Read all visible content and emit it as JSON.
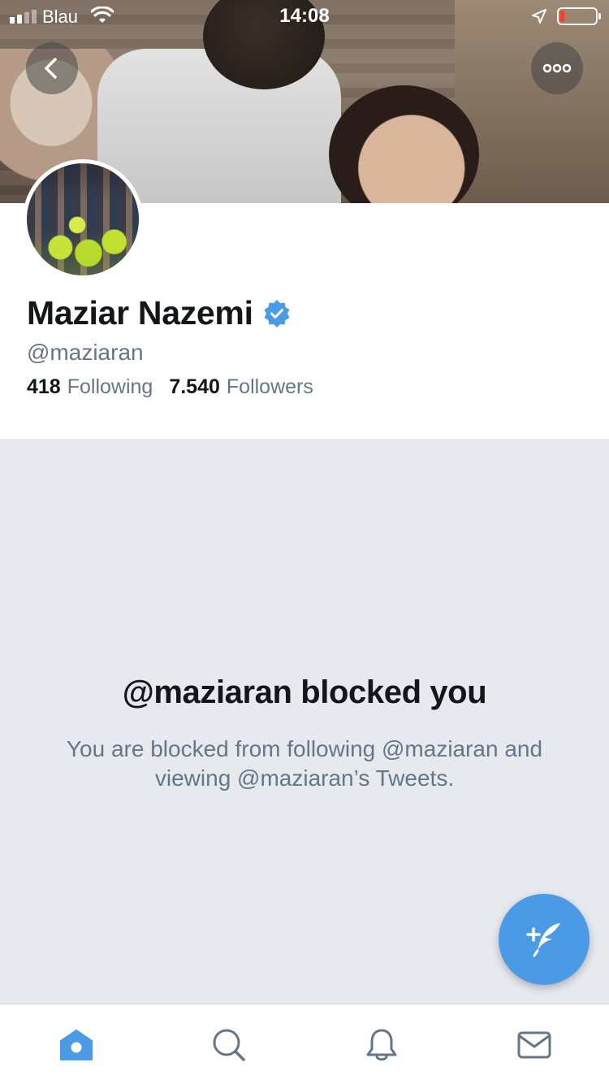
{
  "status_bar": {
    "carrier": "Blau",
    "time": "14:08",
    "signal_bars": 2,
    "battery_level": 0.12
  },
  "header": {
    "back_icon": "chevron-left-icon",
    "more_icon": "more-horizontal-icon"
  },
  "profile": {
    "name": "Maziar Nazemi",
    "verified": true,
    "handle": "@maziaran",
    "following_count": "418",
    "following_label": "Following",
    "followers_count": "7.540",
    "followers_label": "Followers"
  },
  "blocked": {
    "title": "@maziaran blocked you",
    "message": "You are blocked from following @maziaran and viewing @maziaran’s Tweets."
  },
  "fab": {
    "icon": "compose-tweet-icon"
  },
  "tabbar": {
    "items": [
      {
        "icon": "home-icon",
        "active": true
      },
      {
        "icon": "search-icon",
        "active": false
      },
      {
        "icon": "notifications-icon",
        "active": false
      },
      {
        "icon": "messages-icon",
        "active": false
      }
    ]
  },
  "colors": {
    "accent": "#4a9ae6",
    "text_primary": "#14171a",
    "text_secondary": "#657786",
    "blocked_bg": "#e6e9ee"
  }
}
